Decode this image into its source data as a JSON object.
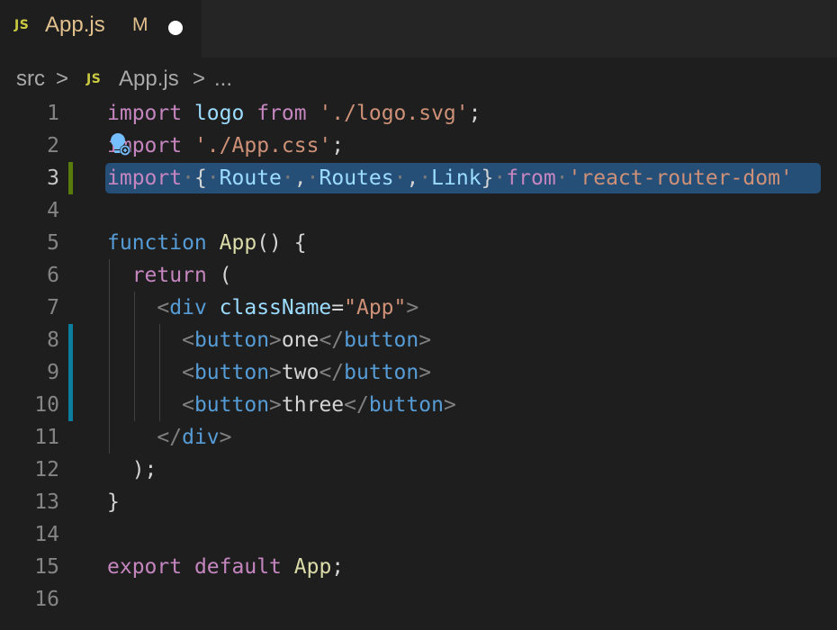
{
  "tab": {
    "icon": "JS",
    "title": "App.js",
    "status": "M"
  },
  "breadcrumb": {
    "folder": "src",
    "separator": ">",
    "icon": "JS",
    "file": "App.js",
    "more": "..."
  },
  "colors": {
    "added": "#587c0c",
    "modified": "#0c7d9d",
    "selection": "#264f78"
  },
  "lines": [
    {
      "n": "1",
      "tokens": [
        [
          "kw",
          "import"
        ],
        [
          "txt",
          " "
        ],
        [
          "id",
          "logo"
        ],
        [
          "txt",
          " "
        ],
        [
          "kw",
          "from"
        ],
        [
          "txt",
          " "
        ],
        [
          "str",
          "'./logo.svg'"
        ],
        [
          "txt",
          ";"
        ]
      ]
    },
    {
      "n": "2",
      "tokens": [
        [
          "kw",
          "import"
        ],
        [
          "txt",
          " "
        ],
        [
          "str",
          "'./App.css'"
        ],
        [
          "txt",
          ";"
        ]
      ]
    },
    {
      "n": "3",
      "tokens": [
        [
          "kw",
          "import"
        ],
        [
          "dim",
          "·"
        ],
        [
          "txt",
          "{"
        ],
        [
          "dim",
          "·"
        ],
        [
          "id",
          "Route"
        ],
        [
          "dim",
          "·"
        ],
        [
          "txt",
          ","
        ],
        [
          "dim",
          "·"
        ],
        [
          "id",
          "Routes"
        ],
        [
          "dim",
          "·"
        ],
        [
          "txt",
          ","
        ],
        [
          "dim",
          "·"
        ],
        [
          "id",
          "Link"
        ],
        [
          "txt",
          "}"
        ],
        [
          "dim",
          "·"
        ],
        [
          "kw",
          "from"
        ],
        [
          "dim",
          "·"
        ],
        [
          "str",
          "'react-router-dom'"
        ]
      ]
    },
    {
      "n": "4",
      "tokens": []
    },
    {
      "n": "5",
      "tokens": [
        [
          "kwb",
          "function"
        ],
        [
          "txt",
          " "
        ],
        [
          "fn",
          "App"
        ],
        [
          "txt",
          "() {"
        ]
      ]
    },
    {
      "n": "6",
      "tokens": [
        [
          "txt",
          "  "
        ],
        [
          "kw",
          "return"
        ],
        [
          "txt",
          " ("
        ]
      ]
    },
    {
      "n": "7",
      "tokens": [
        [
          "txt",
          "    "
        ],
        [
          "br",
          "<"
        ],
        [
          "tag",
          "div"
        ],
        [
          "txt",
          " "
        ],
        [
          "attr",
          "className"
        ],
        [
          "txt",
          "="
        ],
        [
          "str",
          "\"App\""
        ],
        [
          "br",
          ">"
        ]
      ]
    },
    {
      "n": "8",
      "tokens": [
        [
          "txt",
          "      "
        ],
        [
          "br",
          "<"
        ],
        [
          "tag",
          "button"
        ],
        [
          "br",
          ">"
        ],
        [
          "txt",
          "one"
        ],
        [
          "br",
          "</"
        ],
        [
          "tag",
          "button"
        ],
        [
          "br",
          ">"
        ]
      ]
    },
    {
      "n": "9",
      "tokens": [
        [
          "txt",
          "      "
        ],
        [
          "br",
          "<"
        ],
        [
          "tag",
          "button"
        ],
        [
          "br",
          ">"
        ],
        [
          "txt",
          "two"
        ],
        [
          "br",
          "</"
        ],
        [
          "tag",
          "button"
        ],
        [
          "br",
          ">"
        ]
      ]
    },
    {
      "n": "10",
      "tokens": [
        [
          "txt",
          "      "
        ],
        [
          "br",
          "<"
        ],
        [
          "tag",
          "button"
        ],
        [
          "br",
          ">"
        ],
        [
          "txt",
          "three"
        ],
        [
          "br",
          "</"
        ],
        [
          "tag",
          "button"
        ],
        [
          "br",
          ">"
        ]
      ]
    },
    {
      "n": "11",
      "tokens": [
        [
          "txt",
          "    "
        ],
        [
          "br",
          "</"
        ],
        [
          "tag",
          "div"
        ],
        [
          "br",
          ">"
        ]
      ]
    },
    {
      "n": "12",
      "tokens": [
        [
          "txt",
          "  );"
        ]
      ]
    },
    {
      "n": "13",
      "tokens": [
        [
          "txt",
          "}"
        ]
      ]
    },
    {
      "n": "14",
      "tokens": []
    },
    {
      "n": "15",
      "tokens": [
        [
          "kw",
          "export"
        ],
        [
          "txt",
          " "
        ],
        [
          "kw",
          "default"
        ],
        [
          "txt",
          " "
        ],
        [
          "fn",
          "App"
        ],
        [
          "txt",
          ";"
        ]
      ]
    },
    {
      "n": "16",
      "tokens": []
    }
  ]
}
